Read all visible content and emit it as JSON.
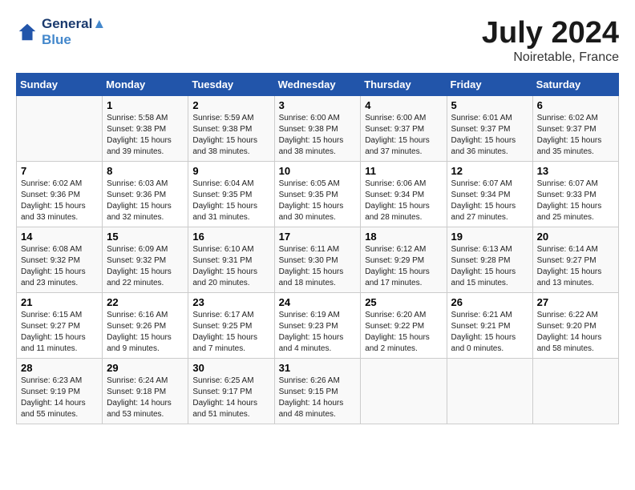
{
  "header": {
    "logo_line1": "General",
    "logo_line2": "Blue",
    "main_title": "July 2024",
    "subtitle": "Noiretable, France"
  },
  "days_of_week": [
    "Sunday",
    "Monday",
    "Tuesday",
    "Wednesday",
    "Thursday",
    "Friday",
    "Saturday"
  ],
  "weeks": [
    [
      {
        "num": "",
        "info": ""
      },
      {
        "num": "1",
        "info": "Sunrise: 5:58 AM\nSunset: 9:38 PM\nDaylight: 15 hours\nand 39 minutes."
      },
      {
        "num": "2",
        "info": "Sunrise: 5:59 AM\nSunset: 9:38 PM\nDaylight: 15 hours\nand 38 minutes."
      },
      {
        "num": "3",
        "info": "Sunrise: 6:00 AM\nSunset: 9:38 PM\nDaylight: 15 hours\nand 38 minutes."
      },
      {
        "num": "4",
        "info": "Sunrise: 6:00 AM\nSunset: 9:37 PM\nDaylight: 15 hours\nand 37 minutes."
      },
      {
        "num": "5",
        "info": "Sunrise: 6:01 AM\nSunset: 9:37 PM\nDaylight: 15 hours\nand 36 minutes."
      },
      {
        "num": "6",
        "info": "Sunrise: 6:02 AM\nSunset: 9:37 PM\nDaylight: 15 hours\nand 35 minutes."
      }
    ],
    [
      {
        "num": "7",
        "info": "Sunrise: 6:02 AM\nSunset: 9:36 PM\nDaylight: 15 hours\nand 33 minutes."
      },
      {
        "num": "8",
        "info": "Sunrise: 6:03 AM\nSunset: 9:36 PM\nDaylight: 15 hours\nand 32 minutes."
      },
      {
        "num": "9",
        "info": "Sunrise: 6:04 AM\nSunset: 9:35 PM\nDaylight: 15 hours\nand 31 minutes."
      },
      {
        "num": "10",
        "info": "Sunrise: 6:05 AM\nSunset: 9:35 PM\nDaylight: 15 hours\nand 30 minutes."
      },
      {
        "num": "11",
        "info": "Sunrise: 6:06 AM\nSunset: 9:34 PM\nDaylight: 15 hours\nand 28 minutes."
      },
      {
        "num": "12",
        "info": "Sunrise: 6:07 AM\nSunset: 9:34 PM\nDaylight: 15 hours\nand 27 minutes."
      },
      {
        "num": "13",
        "info": "Sunrise: 6:07 AM\nSunset: 9:33 PM\nDaylight: 15 hours\nand 25 minutes."
      }
    ],
    [
      {
        "num": "14",
        "info": "Sunrise: 6:08 AM\nSunset: 9:32 PM\nDaylight: 15 hours\nand 23 minutes."
      },
      {
        "num": "15",
        "info": "Sunrise: 6:09 AM\nSunset: 9:32 PM\nDaylight: 15 hours\nand 22 minutes."
      },
      {
        "num": "16",
        "info": "Sunrise: 6:10 AM\nSunset: 9:31 PM\nDaylight: 15 hours\nand 20 minutes."
      },
      {
        "num": "17",
        "info": "Sunrise: 6:11 AM\nSunset: 9:30 PM\nDaylight: 15 hours\nand 18 minutes."
      },
      {
        "num": "18",
        "info": "Sunrise: 6:12 AM\nSunset: 9:29 PM\nDaylight: 15 hours\nand 17 minutes."
      },
      {
        "num": "19",
        "info": "Sunrise: 6:13 AM\nSunset: 9:28 PM\nDaylight: 15 hours\nand 15 minutes."
      },
      {
        "num": "20",
        "info": "Sunrise: 6:14 AM\nSunset: 9:27 PM\nDaylight: 15 hours\nand 13 minutes."
      }
    ],
    [
      {
        "num": "21",
        "info": "Sunrise: 6:15 AM\nSunset: 9:27 PM\nDaylight: 15 hours\nand 11 minutes."
      },
      {
        "num": "22",
        "info": "Sunrise: 6:16 AM\nSunset: 9:26 PM\nDaylight: 15 hours\nand 9 minutes."
      },
      {
        "num": "23",
        "info": "Sunrise: 6:17 AM\nSunset: 9:25 PM\nDaylight: 15 hours\nand 7 minutes."
      },
      {
        "num": "24",
        "info": "Sunrise: 6:19 AM\nSunset: 9:23 PM\nDaylight: 15 hours\nand 4 minutes."
      },
      {
        "num": "25",
        "info": "Sunrise: 6:20 AM\nSunset: 9:22 PM\nDaylight: 15 hours\nand 2 minutes."
      },
      {
        "num": "26",
        "info": "Sunrise: 6:21 AM\nSunset: 9:21 PM\nDaylight: 15 hours\nand 0 minutes."
      },
      {
        "num": "27",
        "info": "Sunrise: 6:22 AM\nSunset: 9:20 PM\nDaylight: 14 hours\nand 58 minutes."
      }
    ],
    [
      {
        "num": "28",
        "info": "Sunrise: 6:23 AM\nSunset: 9:19 PM\nDaylight: 14 hours\nand 55 minutes."
      },
      {
        "num": "29",
        "info": "Sunrise: 6:24 AM\nSunset: 9:18 PM\nDaylight: 14 hours\nand 53 minutes."
      },
      {
        "num": "30",
        "info": "Sunrise: 6:25 AM\nSunset: 9:17 PM\nDaylight: 14 hours\nand 51 minutes."
      },
      {
        "num": "31",
        "info": "Sunrise: 6:26 AM\nSunset: 9:15 PM\nDaylight: 14 hours\nand 48 minutes."
      },
      {
        "num": "",
        "info": ""
      },
      {
        "num": "",
        "info": ""
      },
      {
        "num": "",
        "info": ""
      }
    ]
  ]
}
